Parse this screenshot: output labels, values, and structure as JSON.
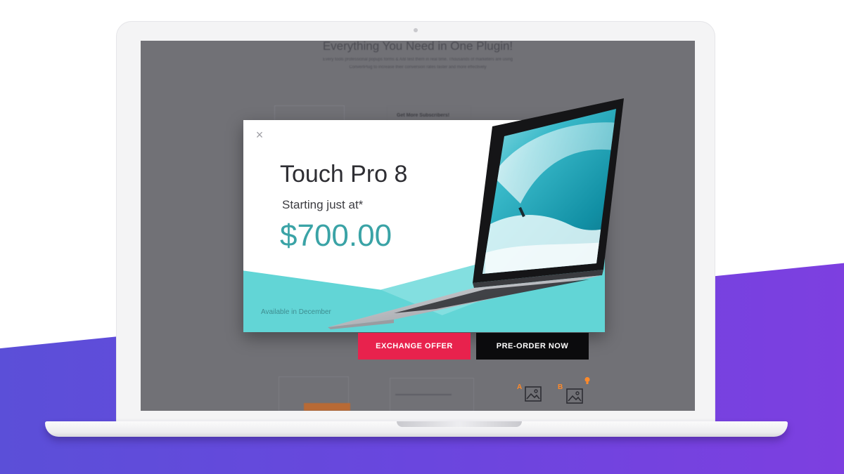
{
  "background_page": {
    "heading": "Everything You Need in One Plugin!",
    "subtext_line1": "Every tools professional popups forms & A/B test them in real time. Thousands of marketers are using",
    "subtext_line2": "ConvertPlug to increase their conversion rates faster and more effectively",
    "card_title": "Get More Subscribers!",
    "variant_a": "A",
    "variant_b": "B"
  },
  "popup": {
    "close_glyph": "×",
    "title": "Touch Pro 8",
    "subtitle": "Starting just at*",
    "price": "$700.00",
    "availability": "Available in December"
  },
  "actions": {
    "exchange_label": "EXCHANGE OFFER",
    "preorder_label": "PRE-ORDER NOW"
  },
  "colors": {
    "purple_band": "#6a46de",
    "teal": "#62d5d6",
    "price_teal": "#3aa3a6",
    "exchange_red": "#e8224d",
    "preorder_black": "#0b0b0d",
    "screen_overlay": "#717176"
  }
}
